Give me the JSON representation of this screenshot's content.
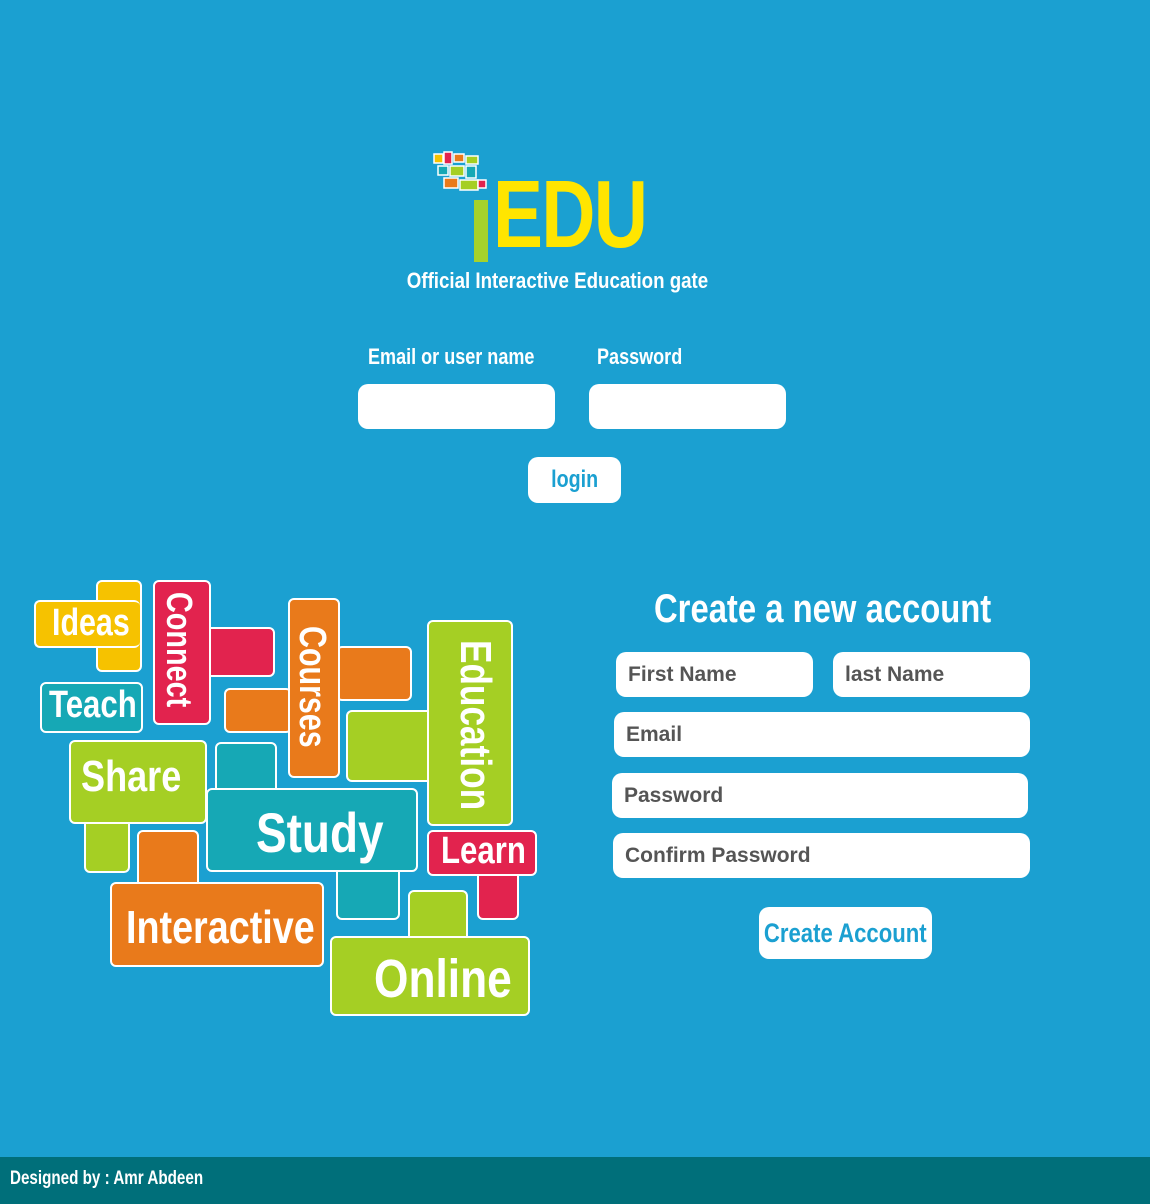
{
  "header": {
    "logo_text": "EDU",
    "tagline": "Official Interactive Education gate"
  },
  "login": {
    "email_label": "Email or user name",
    "password_label": "Password",
    "email_value": "",
    "password_value": "",
    "button_label": "login"
  },
  "collage": {
    "words": [
      "Ideas",
      "Connect",
      "Courses",
      "Education",
      "Teach",
      "Share",
      "Study",
      "Learn",
      "Interactive",
      "Online"
    ]
  },
  "register": {
    "title": "Create a new account",
    "first_name_placeholder": "First Name",
    "last_name_placeholder": "last Name",
    "email_placeholder": "Email",
    "password_placeholder": "Password",
    "confirm_placeholder": "Confirm Password",
    "button_label": "Create Account"
  },
  "footer": {
    "credit": "Designed by : Amr Abdeen"
  },
  "colors": {
    "background": "#1ba0d1",
    "logo_yellow": "#ffe500",
    "logo_green": "#a6d22b",
    "footer": "#006f7a",
    "yellow": "#f6c200",
    "red": "#e2234e",
    "orange": "#e97a1b",
    "green": "#a5cf24",
    "teal": "#16a8b5"
  }
}
